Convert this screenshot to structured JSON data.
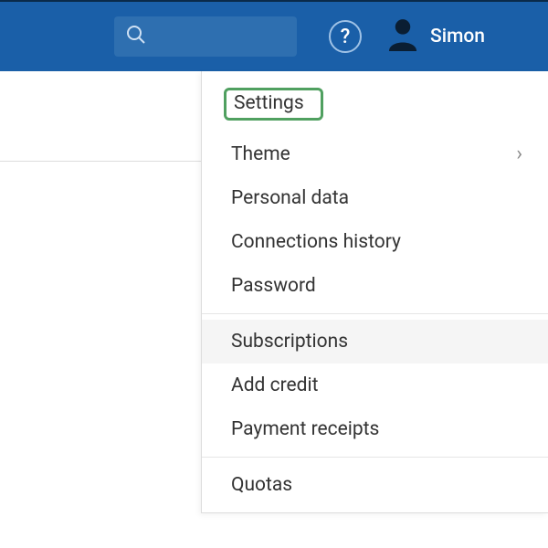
{
  "header": {
    "search_placeholder": "",
    "help_label": "?",
    "username": "Simon"
  },
  "menu": {
    "groups": [
      {
        "items": [
          {
            "label": "Settings",
            "highlighted": true
          },
          {
            "label": "Theme",
            "submenu": true
          },
          {
            "label": "Personal data"
          },
          {
            "label": "Connections history"
          },
          {
            "label": "Password"
          }
        ]
      },
      {
        "items": [
          {
            "label": "Subscriptions",
            "hovered": true
          },
          {
            "label": "Add credit"
          },
          {
            "label": "Payment receipts"
          }
        ]
      },
      {
        "items": [
          {
            "label": "Quotas"
          }
        ]
      }
    ]
  }
}
